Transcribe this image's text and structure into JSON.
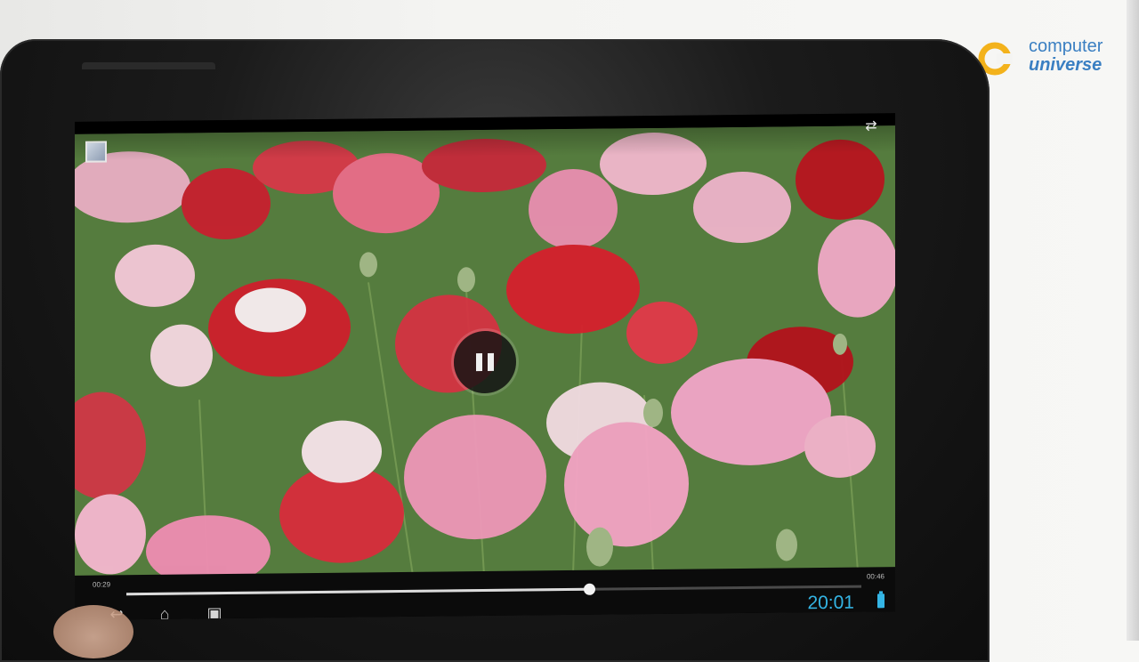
{
  "watermark": {
    "line1": "computer",
    "line2": "universe",
    "brand_color": "#3a7fc2",
    "mark_color": "#f3b21b"
  },
  "video_player": {
    "elapsed_time": "00:29",
    "total_time": "00:46",
    "progress_fraction": 0.63,
    "state": "playing",
    "pause_icon": "pause-icon",
    "share_icon": "share-icon",
    "thumbnail_icon": "gallery-thumbnail-icon"
  },
  "system_bar": {
    "back_icon": "back-icon",
    "home_icon": "home-icon",
    "recent_apps_icon": "recent-apps-icon",
    "clock": "20:01",
    "battery_icon": "battery-icon",
    "accent_color": "#34b5e5"
  }
}
